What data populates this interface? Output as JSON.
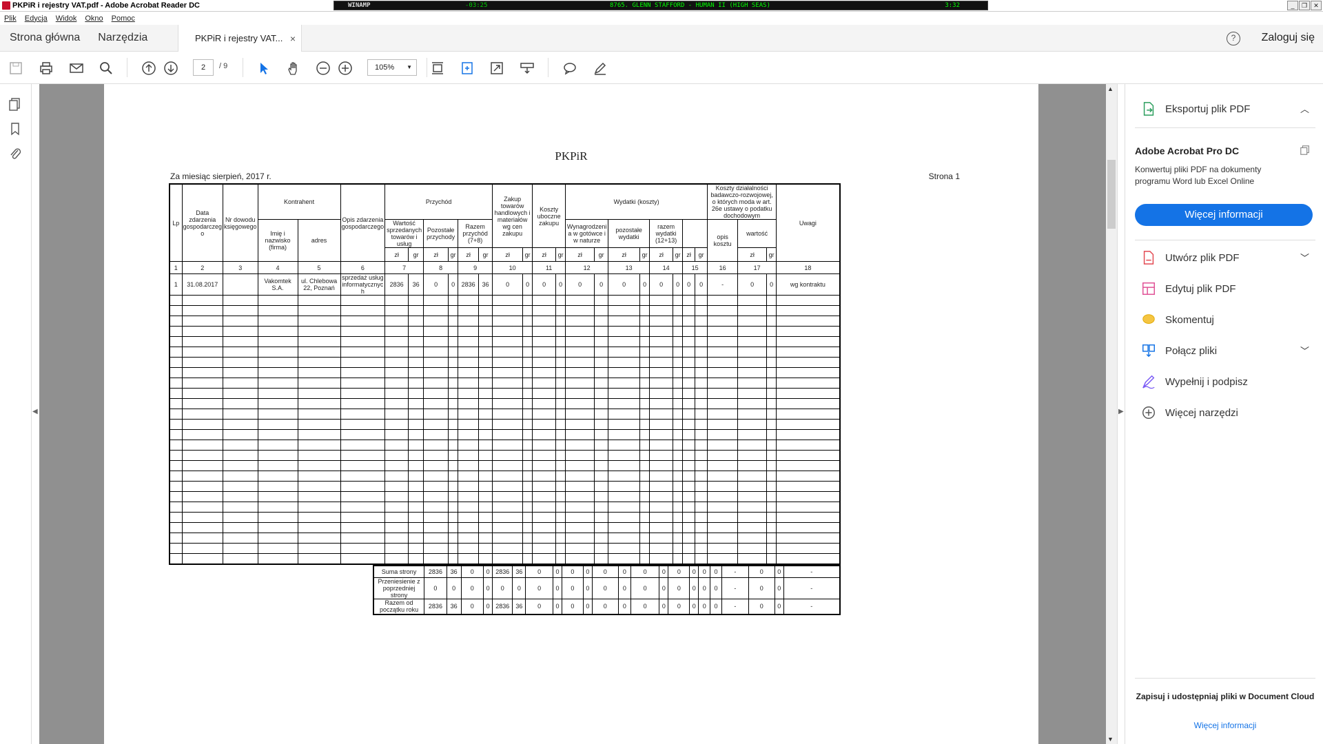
{
  "window": {
    "title": "PKPiR i rejestry VAT.pdf - Adobe Acrobat Reader DC"
  },
  "winamp": {
    "label": "WINAMP",
    "time": "-03:25",
    "song": "8765. GLENN STAFFORD - HUMAN II (HIGH SEAS)",
    "duration": "3:32"
  },
  "menu": [
    "Plik",
    "Edycja",
    "Widok",
    "Okno",
    "Pomoc"
  ],
  "tabs": {
    "home": "Strona główna",
    "tools": "Narzędzia",
    "doc": "PKPiR i rejestry VAT...",
    "close": "×",
    "login": "Zaloguj się",
    "help": "?"
  },
  "toolbar": {
    "page_current": "2",
    "page_total": "/ 9",
    "zoom": "105%"
  },
  "right_pane": {
    "export": "Eksportuj plik PDF",
    "pro_title": "Adobe Acrobat Pro DC",
    "pro_desc": "Konwertuj pliki PDF na dokumenty programu Word lub Excel Online",
    "pro_button": "Więcej informacji",
    "tools": [
      "Utwórz plik PDF",
      "Edytuj plik PDF",
      "Skomentuj",
      "Połącz pliki",
      "Wypełnij i podpisz",
      "Więcej narzędzi"
    ],
    "cloud_title": "Zapisuj i udostępniaj pliki w Document Cloud",
    "cloud_link": "Więcej informacji"
  },
  "doc": {
    "title": "PKPiR",
    "month": "Za miesiąc sierpień, 2017 r.",
    "page": "Strona 1",
    "headers": {
      "lp": "Lp",
      "date": "Data zdarzenia gospodarczeg o",
      "nr": "Nr dowodu księgowego",
      "kontrahent": "Kontrahent",
      "name": "Imię i nazwisko (firma)",
      "addr": "adres",
      "opis": "Opis zdarzenia gospodarczego",
      "przychod": "Przychód",
      "wartosc": "Wartość sprzedanych towarów i usług",
      "pozostale": "Pozostałe przychody",
      "razem": "Razem przychód (7+8)",
      "zakup": "Zakup towarów handlowych i materiałów wg cen zakupu",
      "koszty": "Koszty uboczne zakupu",
      "wydatki": "Wydatki (koszty)",
      "wynagr": "Wynagrodzeni a w gotówce i w naturze",
      "pozwyd": "pozostałe wydatki",
      "razwyd": "razem wydatki (12+13)",
      "badawcze": "Koszty działalności badawczo-rozwojowej, o których moda w art. 26e ustawy o podatku dochodowym",
      "opiskosztu": "opis kosztu",
      "wartosc2": "wartość",
      "uwagi": "Uwagi",
      "zl": "zł",
      "gr": "gr"
    },
    "numbers": [
      "1",
      "2",
      "3",
      "4",
      "5",
      "6",
      "7",
      "8",
      "9",
      "10",
      "11",
      "12",
      "13",
      "14",
      "15",
      "16",
      "17",
      "18"
    ],
    "row1": {
      "lp": "1",
      "date": "31.08.2017",
      "nr": "",
      "name": "Vakomtek S.A.",
      "addr": "ul. Chlebowa 22, Poznań",
      "opis": "sprzedaż usług informatycznyc h",
      "v": [
        "2836",
        "36",
        "0",
        "0",
        "2836",
        "36",
        "0",
        "0",
        "0",
        "0",
        "0",
        "0",
        "0",
        "0",
        "0",
        "0",
        "0",
        "0",
        "-",
        "0",
        "0"
      ],
      "uwagi": "wg kontraktu"
    },
    "summary": [
      {
        "label": "Suma strony",
        "v": [
          "2836",
          "36",
          "0",
          "0",
          "2836",
          "36",
          "0",
          "0",
          "0",
          "0",
          "0",
          "0",
          "0",
          "0",
          "0",
          "0",
          "0",
          "0",
          "-",
          "0",
          "0",
          "-"
        ]
      },
      {
        "label": "Przeniesienie z poprzedniej strony",
        "v": [
          "0",
          "0",
          "0",
          "0",
          "0",
          "0",
          "0",
          "0",
          "0",
          "0",
          "0",
          "0",
          "0",
          "0",
          "0",
          "0",
          "0",
          "0",
          "-",
          "0",
          "0",
          "-"
        ]
      },
      {
        "label": "Razem od początku roku",
        "v": [
          "2836",
          "36",
          "0",
          "0",
          "2836",
          "36",
          "0",
          "0",
          "0",
          "0",
          "0",
          "0",
          "0",
          "0",
          "0",
          "0",
          "0",
          "0",
          "-",
          "0",
          "0",
          "-"
        ]
      }
    ]
  }
}
